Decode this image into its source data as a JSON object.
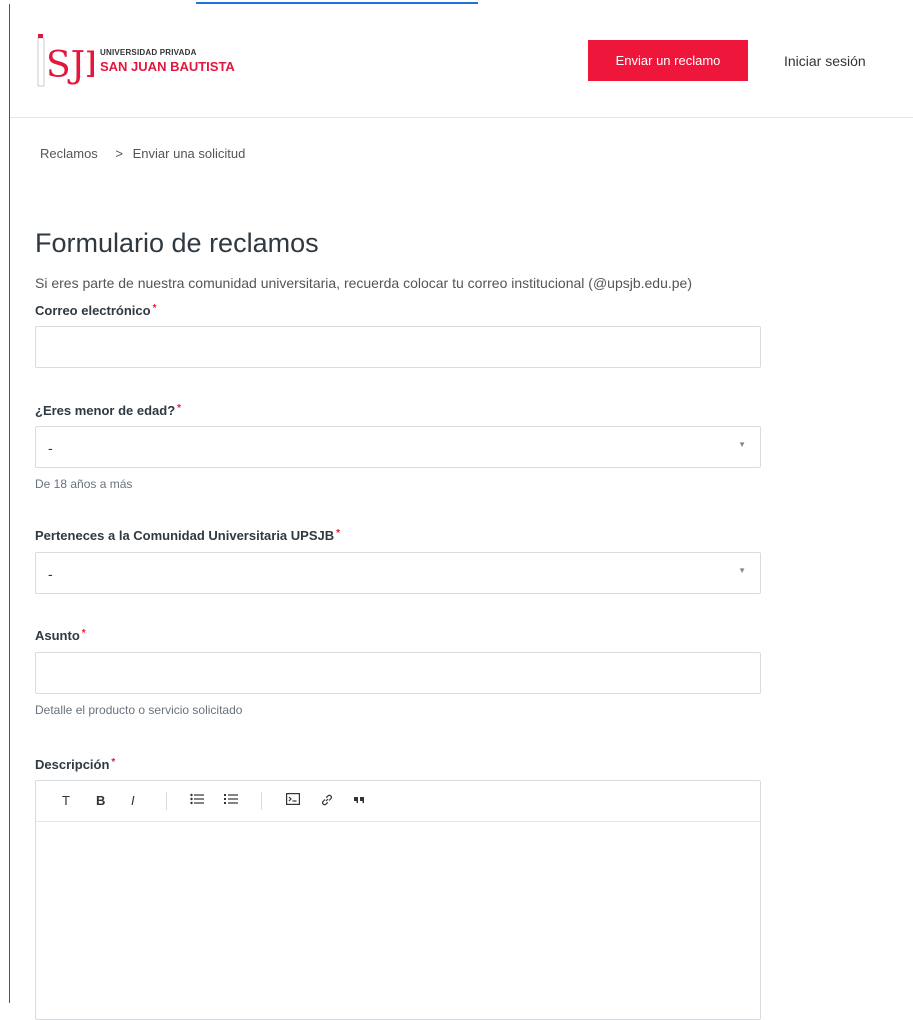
{
  "header": {
    "logo_small_text": "UNIVERSIDAD PRIVADA",
    "logo_brand_text": "SAN JUAN BAUTISTA",
    "logo_mark_text": "SJB",
    "submit_button": "Enviar un reclamo",
    "signin_link": "Iniciar sesión"
  },
  "breadcrumb": {
    "root": "Reclamos",
    "separator": ">",
    "current": "Enviar una solicitud"
  },
  "form": {
    "title": "Formulario de reclamos",
    "subtitle": "Si eres parte de nuestra comunidad universitaria, recuerda colocar tu correo institucional (@upsjb.edu.pe)",
    "required_mark": "*",
    "email": {
      "label": "Correo electrónico",
      "value": ""
    },
    "minor": {
      "label": "¿Eres menor de edad?",
      "value": "-",
      "hint": "De 18 años a más"
    },
    "community": {
      "label": "Perteneces a la Comunidad Universitaria UPSJB",
      "value": "-"
    },
    "subject": {
      "label": "Asunto",
      "value": "",
      "hint": "Detalle el producto o servicio solicitado"
    },
    "description": {
      "label": "Descripción",
      "value": ""
    }
  },
  "toolbar": {
    "text_icon": "T",
    "bold_icon": "B",
    "italic_icon": "I",
    "icons": [
      "text-icon",
      "bold-icon",
      "italic-icon",
      "bulleted-list-icon",
      "numbered-list-icon",
      "code-icon",
      "link-icon",
      "quote-icon"
    ]
  },
  "colors": {
    "accent": "#ef163c",
    "text": "#2f3941",
    "border": "#d8dcde"
  }
}
